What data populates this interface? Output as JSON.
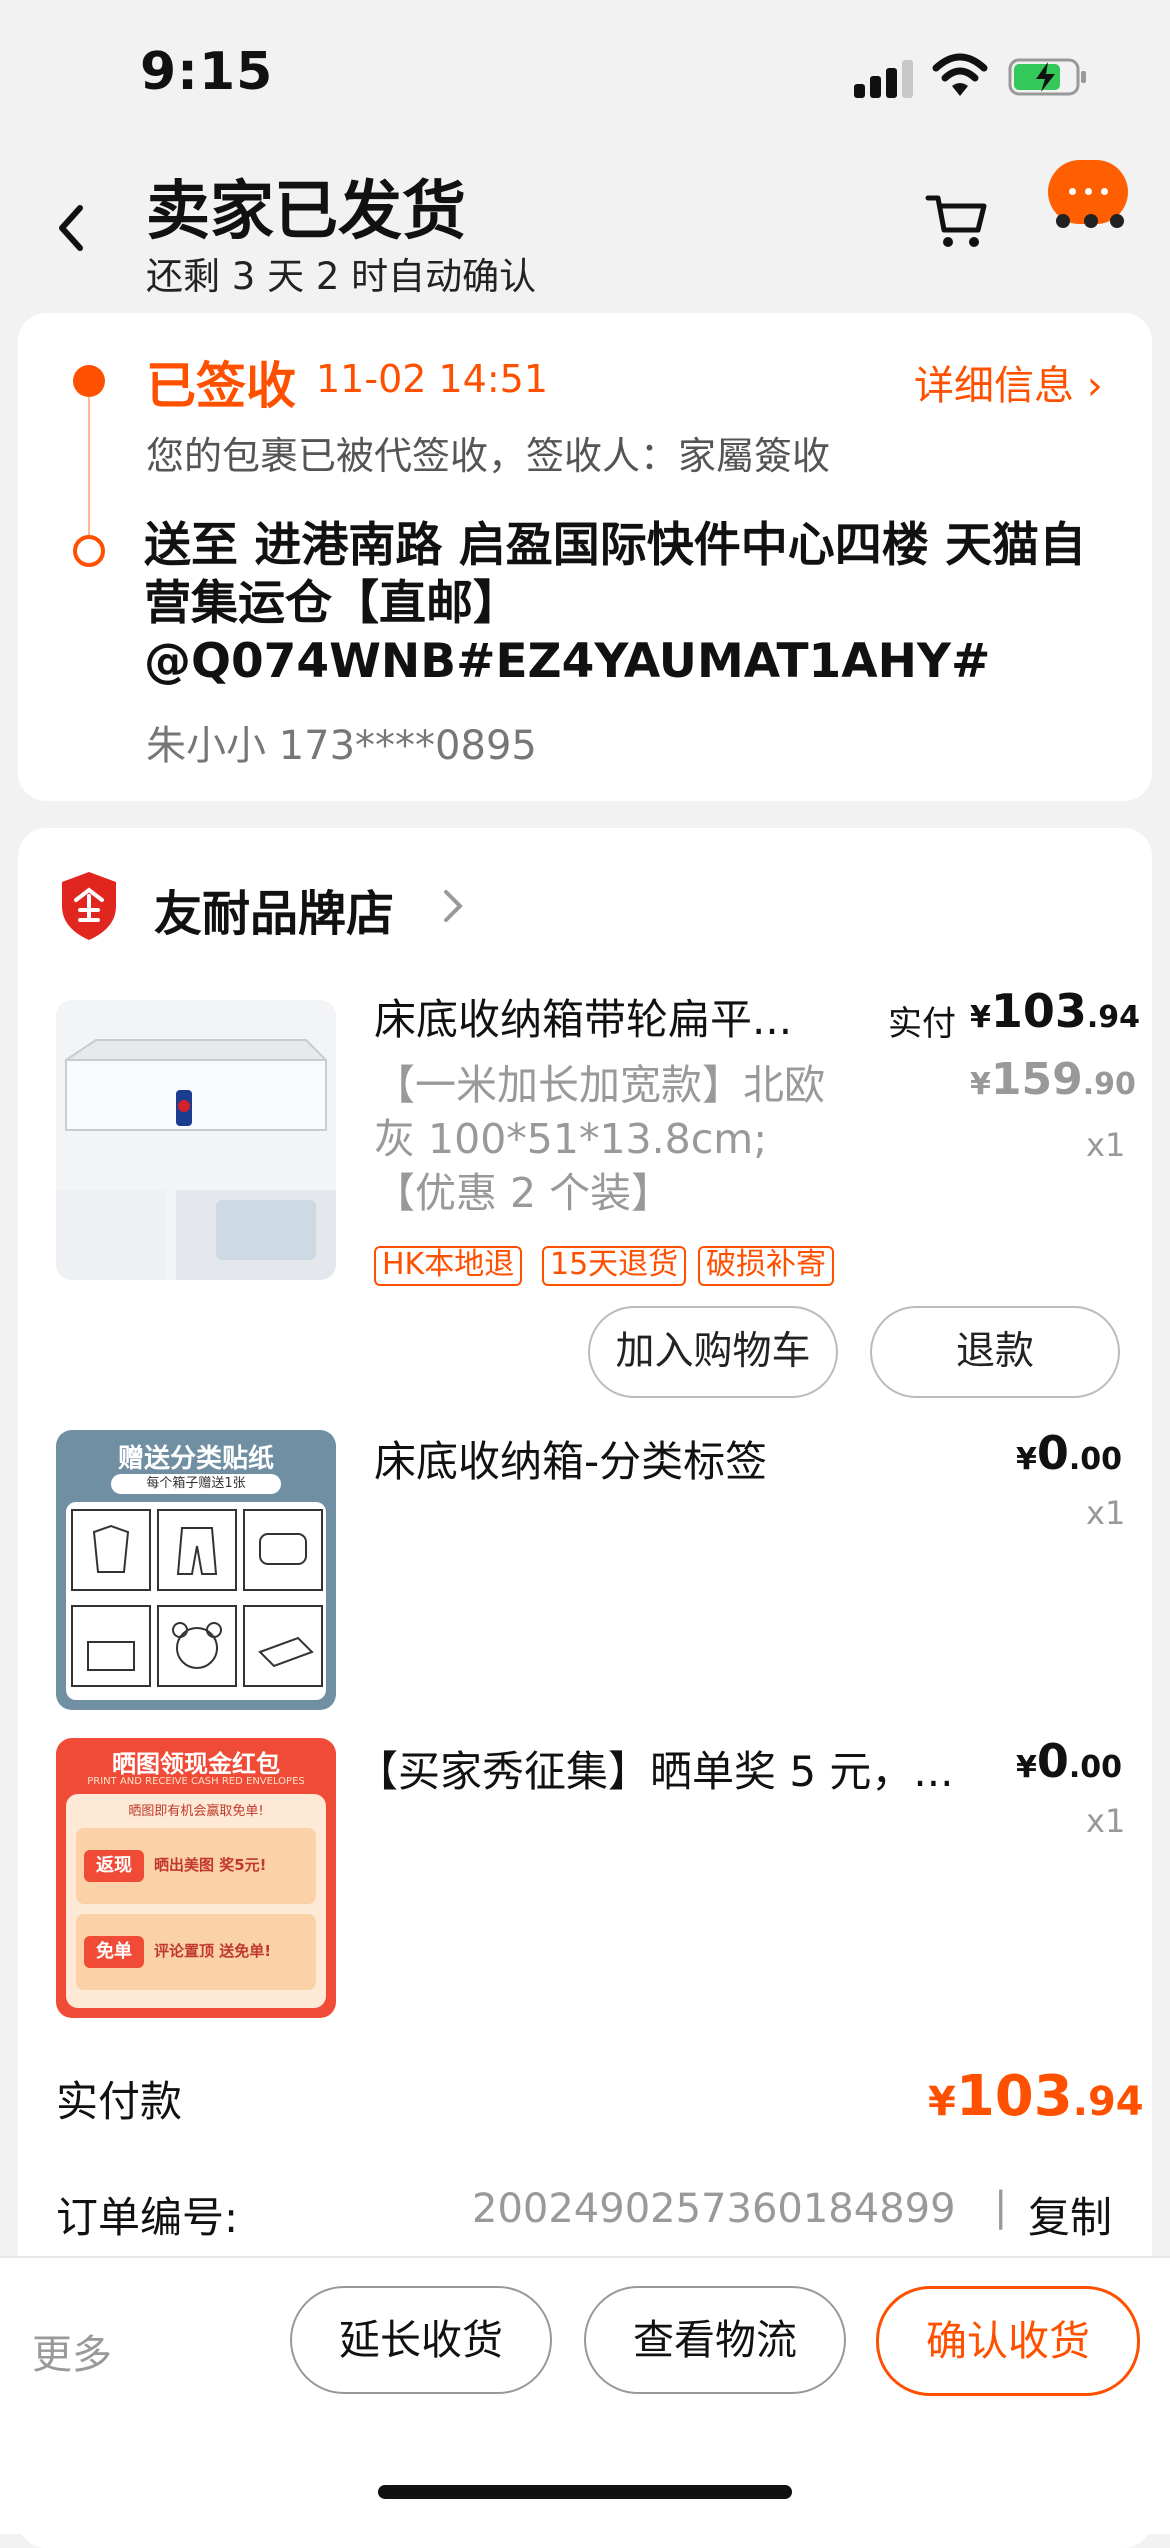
{
  "status": {
    "time": "9:15"
  },
  "header": {
    "title": "卖家已发货",
    "subtitle": "还剩 3 天 2 时自动确认",
    "more_dots": "···"
  },
  "logistics": {
    "status": "已签收",
    "time": "11-02 14:51",
    "detail_link": "详细信息 ›",
    "description": "您的包裹已被代签收，签收人：家屬簽收",
    "address": "送至 进港南路 启盈国际快件中心四楼 天猫自营集运仓【直邮】@Q074WNB#EZ4YAUMAT1AHY#",
    "receiver": "朱小小 173****0895"
  },
  "shop": {
    "name": "友耐品牌店"
  },
  "items": [
    {
      "title": "床底收纳箱带轮扁平...",
      "sku": "【一米加长加宽款】北欧灰 100*51*13.8cm;【优惠 2 个装】",
      "paid_label": "实付",
      "currency": "¥",
      "price_int": "103",
      "price_dec": ".94",
      "orig_int": "159",
      "orig_dec": ".90",
      "qty": "x1",
      "tags": [
        "HK本地退",
        "15天退货",
        "破损补寄"
      ],
      "buttons": [
        "加入购物车",
        "退款"
      ]
    },
    {
      "title": "床底收纳箱-分类标签",
      "currency": "¥",
      "price_int": "0",
      "price_dec": ".00",
      "qty": "x1",
      "image_text": {
        "title": "赠送分类贴纸",
        "subtitle": "每个箱子赠送1张"
      }
    },
    {
      "title": "【买家秀征集】晒单奖 5 元，...",
      "currency": "¥",
      "price_int": "0",
      "price_dec": ".00",
      "qty": "x1",
      "image_text": {
        "title": "晒图领现金红包",
        "subtitle": "PRINT AND RECEIVE CASH RED ENVELOPES",
        "line1": "晒图即有机会赢取免单!",
        "badge1": "返现",
        "text1": "晒出美图 奖5元!",
        "badge2": "免单",
        "text2": "评论置顶 送免单!"
      }
    }
  ],
  "summary": {
    "paid_label": "实付款",
    "currency": "¥",
    "paid_int": "103",
    "paid_dec": ".94",
    "order_no_label": "订单编号:",
    "order_no": "2002490257360184899",
    "separator": "|",
    "copy_label": "复制"
  },
  "bottom": {
    "more": "更多",
    "extend": "延长收货",
    "track": "查看物流",
    "confirm": "确认收货"
  },
  "colors": {
    "accent": "#ff5000",
    "shop_badge": "#e0261f"
  }
}
